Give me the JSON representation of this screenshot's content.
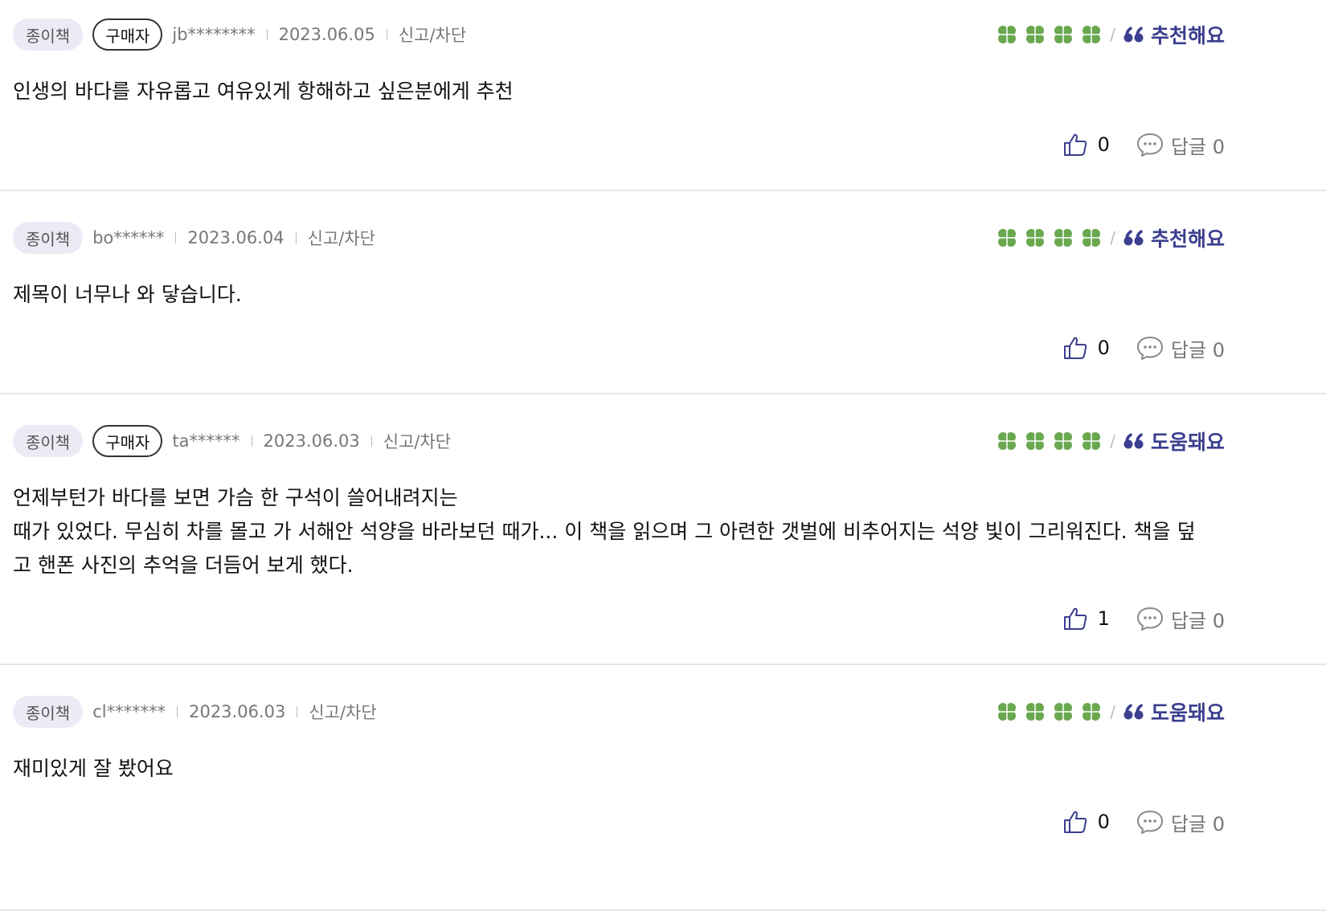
{
  "reviews": [
    {
      "type_badge": "종이책",
      "buyer_badge": "구매자",
      "user_id": "jb********",
      "date": "2023.06.05",
      "report_label": "신고/차단",
      "rating_clovers": 4,
      "rating_label": "추천해요",
      "body_lines": [
        "인생의 바다를 자유롭고 여유있게 항해하고 싶은분에게 추천"
      ],
      "like_count": "0",
      "reply_label": "답글 0"
    },
    {
      "type_badge": "종이책",
      "buyer_badge": "",
      "user_id": "bo******",
      "date": "2023.06.04",
      "report_label": "신고/차단",
      "rating_clovers": 4,
      "rating_label": "추천해요",
      "body_lines": [
        "제목이 너무나 와 닿습니다."
      ],
      "like_count": "0",
      "reply_label": "답글 0"
    },
    {
      "type_badge": "종이책",
      "buyer_badge": "구매자",
      "user_id": "ta******",
      "date": "2023.06.03",
      "report_label": "신고/차단",
      "rating_clovers": 4,
      "rating_label": "도움돼요",
      "body_lines": [
        "언제부턴가 바다를 보면 가슴 한 구석이 쓸어내려지는",
        "때가 있었다. 무심히 차를 몰고 가 서해안 석양을 바라보던 때가... 이 책을 읽으며 그 아련한 갯벌에 비추어지는 석양 빛이 그리워진다. 책을 덮",
        "고 핸폰 사진의 추억을 더듬어 보게 했다."
      ],
      "like_count": "1",
      "reply_label": "답글 0"
    },
    {
      "type_badge": "종이책",
      "buyer_badge": "",
      "user_id": "cl*******",
      "date": "2023.06.03",
      "report_label": "신고/차단",
      "rating_clovers": 4,
      "rating_label": "도움돼요",
      "body_lines": [
        "재미있게 잘 봤어요"
      ],
      "like_count": "0",
      "reply_label": "답글 0"
    }
  ],
  "colors": {
    "clover_green": "#6aa84f",
    "rating_text": "#3b3f8f",
    "badge_bg": "#ebebf5",
    "meta_gray": "#777777",
    "divider": "#e6e6e6"
  },
  "icons": {
    "rating": "clover-icon",
    "quote": "quote-icon",
    "like": "thumbs-up-icon",
    "reply": "speech-bubble-icon"
  }
}
